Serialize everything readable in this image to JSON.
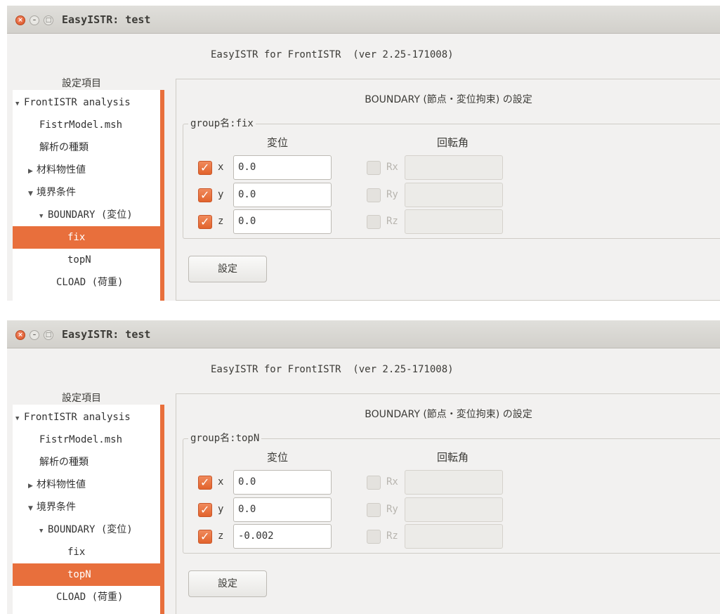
{
  "screens": [
    {
      "window_title": "EasyISTR: test",
      "app_title": "EasyISTR for FrontISTR  (ver 2.25-171008)",
      "tree_header": "設定項目",
      "tree": [
        {
          "label": "FrontISTR analysis",
          "toggle": "▼",
          "selected": false
        },
        {
          "label": "FistrModel.msh",
          "toggle": "",
          "selected": false
        },
        {
          "label": "解析の種類",
          "toggle": "",
          "selected": false
        },
        {
          "label": "材料物性値",
          "toggle": "▶",
          "selected": false
        },
        {
          "label": "境界条件",
          "toggle": "▼",
          "selected": false
        },
        {
          "label": "BOUNDARY (変位)",
          "toggle": "▼",
          "selected": false
        },
        {
          "label": "fix",
          "toggle": "",
          "selected": true
        },
        {
          "label": "topN",
          "toggle": "",
          "selected": false
        },
        {
          "label": "CLOAD (荷重)",
          "toggle": "",
          "selected": false
        }
      ],
      "panel_title": "BOUNDARY (節点・変位拘束) の設定",
      "group_label": "group名:fix",
      "disp_header": "変位",
      "rot_header": "回転角",
      "disp_rows": [
        {
          "label": "x",
          "checked": true,
          "value": "0.0"
        },
        {
          "label": "y",
          "checked": true,
          "value": "0.0"
        },
        {
          "label": "z",
          "checked": true,
          "value": "0.0"
        }
      ],
      "rot_rows": [
        {
          "label": "Rx",
          "checked": false,
          "value": ""
        },
        {
          "label": "Ry",
          "checked": false,
          "value": ""
        },
        {
          "label": "Rz",
          "checked": false,
          "value": ""
        }
      ],
      "set_button": "設定"
    },
    {
      "window_title": "EasyISTR: test",
      "app_title": "EasyISTR for FrontISTR  (ver 2.25-171008)",
      "tree_header": "設定項目",
      "tree": [
        {
          "label": "FrontISTR analysis",
          "toggle": "▼",
          "selected": false
        },
        {
          "label": "FistrModel.msh",
          "toggle": "",
          "selected": false
        },
        {
          "label": "解析の種類",
          "toggle": "",
          "selected": false
        },
        {
          "label": "材料物性値",
          "toggle": "▶",
          "selected": false
        },
        {
          "label": "境界条件",
          "toggle": "▼",
          "selected": false
        },
        {
          "label": "BOUNDARY (変位)",
          "toggle": "▼",
          "selected": false
        },
        {
          "label": "fix",
          "toggle": "",
          "selected": false
        },
        {
          "label": "topN",
          "toggle": "",
          "selected": true
        },
        {
          "label": "CLOAD (荷重)",
          "toggle": "",
          "selected": false
        }
      ],
      "panel_title": "BOUNDARY (節点・変位拘束) の設定",
      "group_label": "group名:topN",
      "disp_header": "変位",
      "rot_header": "回転角",
      "disp_rows": [
        {
          "label": "x",
          "checked": true,
          "value": "0.0"
        },
        {
          "label": "y",
          "checked": true,
          "value": "0.0"
        },
        {
          "label": "z",
          "checked": true,
          "value": "-0.002"
        }
      ],
      "rot_rows": [
        {
          "label": "Rx",
          "checked": false,
          "value": ""
        },
        {
          "label": "Ry",
          "checked": false,
          "value": ""
        },
        {
          "label": "Rz",
          "checked": false,
          "value": ""
        }
      ],
      "set_button": "設定"
    }
  ],
  "colors": {
    "accent": "#e86f3c",
    "background": "#f2f1f0"
  }
}
